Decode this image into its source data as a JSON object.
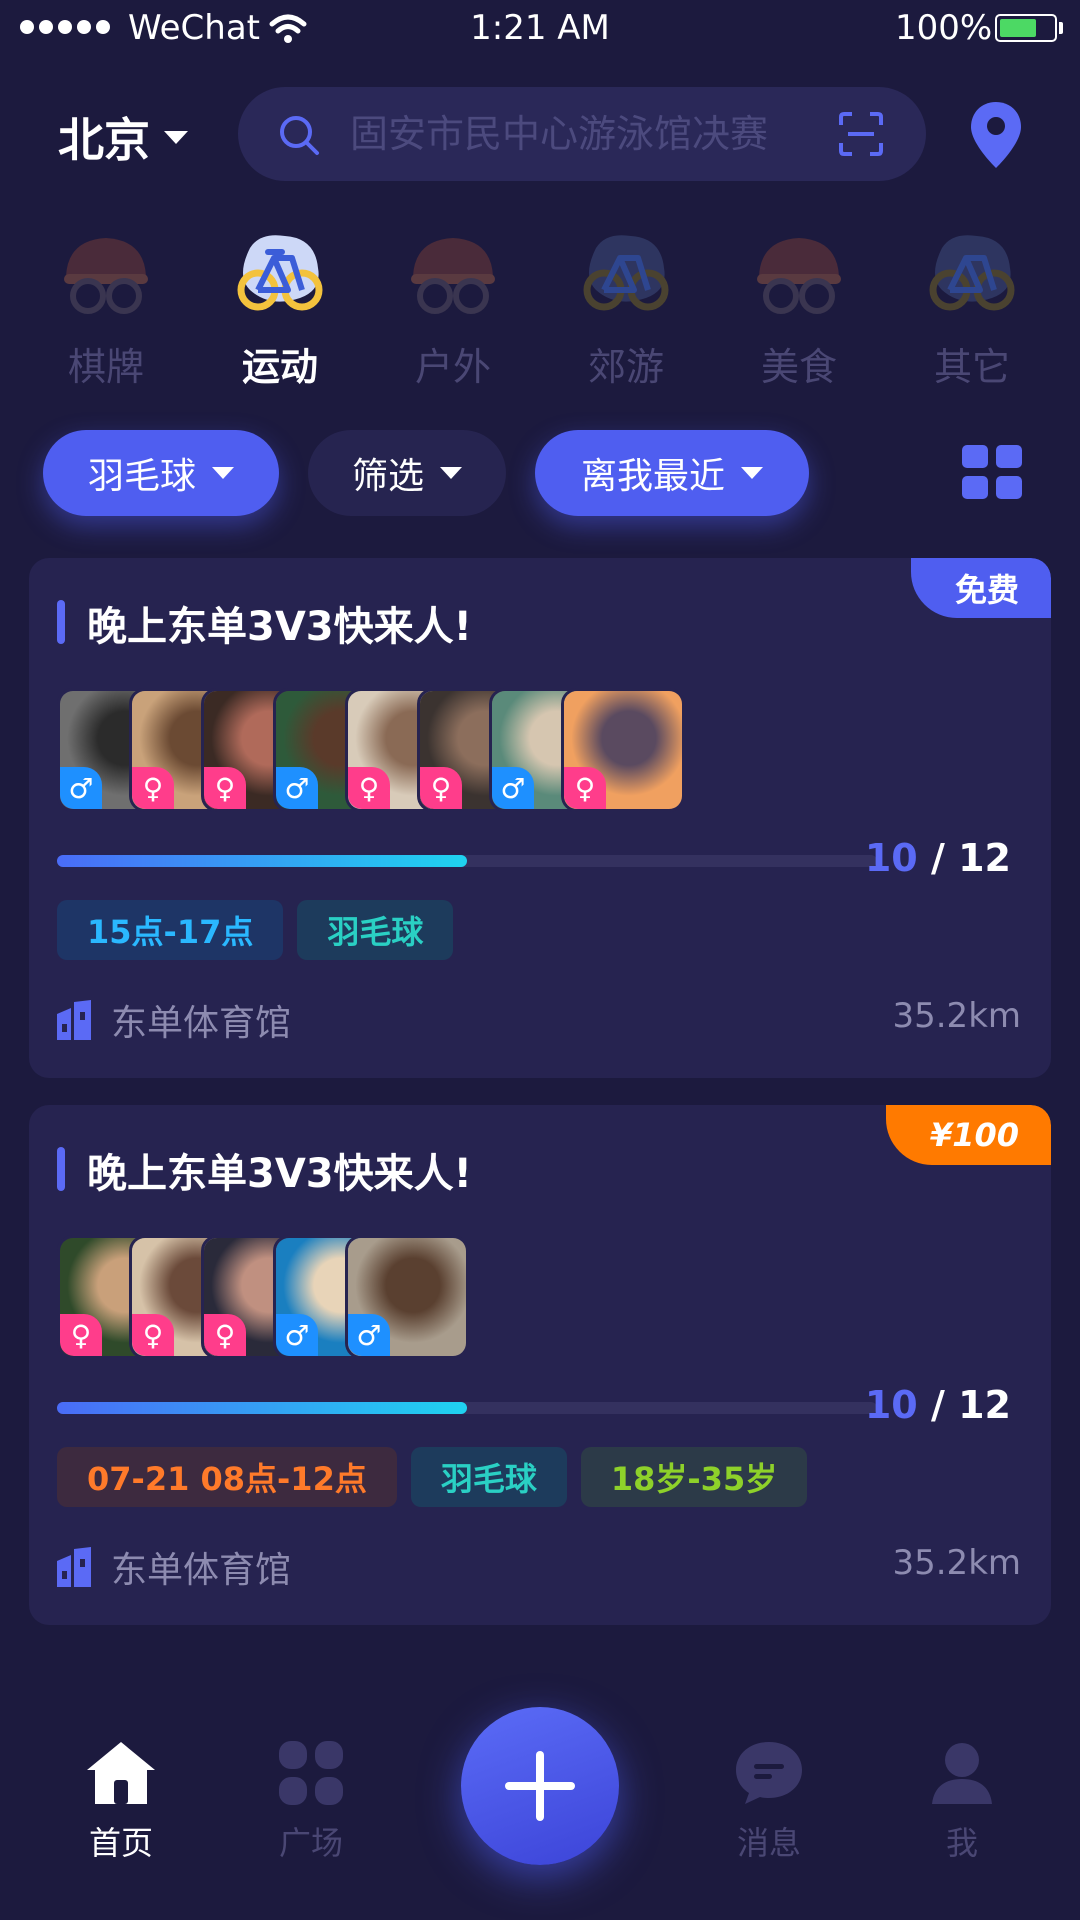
{
  "status_bar": {
    "carrier": "WeChat",
    "time": "1:21 AM",
    "battery": "100%"
  },
  "header": {
    "city": "北京",
    "search_placeholder": "固安市民中心游泳馆决赛"
  },
  "categories": [
    {
      "label": "棋牌",
      "icon": "helmet-goggles-icon",
      "active": false
    },
    {
      "label": "运动",
      "icon": "bicycle-icon",
      "active": true
    },
    {
      "label": "户外",
      "icon": "helmet-goggles-icon",
      "active": false
    },
    {
      "label": "郊游",
      "icon": "bicycle-icon",
      "active": false
    },
    {
      "label": "美食",
      "icon": "helmet-goggles-icon",
      "active": false
    },
    {
      "label": "其它",
      "icon": "bicycle-icon",
      "active": false
    }
  ],
  "filters": {
    "sport": "羽毛球",
    "filter": "筛选",
    "sort": "离我最近"
  },
  "cards": [
    {
      "title": "晚上东单3V3快来人!",
      "price": "免费",
      "price_type": "free",
      "participants": [
        "male",
        "female",
        "female",
        "male",
        "female",
        "female",
        "male",
        "female"
      ],
      "progress": 0.5,
      "current": "10",
      "separator": "/",
      "total": "12",
      "tags": [
        {
          "text": "15点-17点",
          "style": "blue"
        },
        {
          "text": "羽毛球",
          "style": "cyan"
        }
      ],
      "venue": "东单体育馆",
      "distance": "35.2km"
    },
    {
      "title": "晚上东单3V3快来人!",
      "price": "¥100",
      "price_type": "paid",
      "participants": [
        "female",
        "female",
        "female",
        "male",
        "male"
      ],
      "progress": 0.5,
      "current": "10",
      "separator": "/",
      "total": "12",
      "tags": [
        {
          "text": "07-21  08点-12点",
          "style": "orange"
        },
        {
          "text": "羽毛球",
          "style": "cyan"
        },
        {
          "text": "18岁-35岁",
          "style": "green"
        }
      ],
      "venue": "东单体育馆",
      "distance": "35.2km"
    }
  ],
  "tabbar": {
    "home": "首页",
    "square": "广场",
    "messages": "消息",
    "me": "我"
  },
  "colors": {
    "background": "#1c1a3e",
    "accent": "#4f5ef0",
    "card": "#262350",
    "paid_badge": "#ff7a00",
    "male": "#1e90ff",
    "female": "#ff3d8b"
  }
}
